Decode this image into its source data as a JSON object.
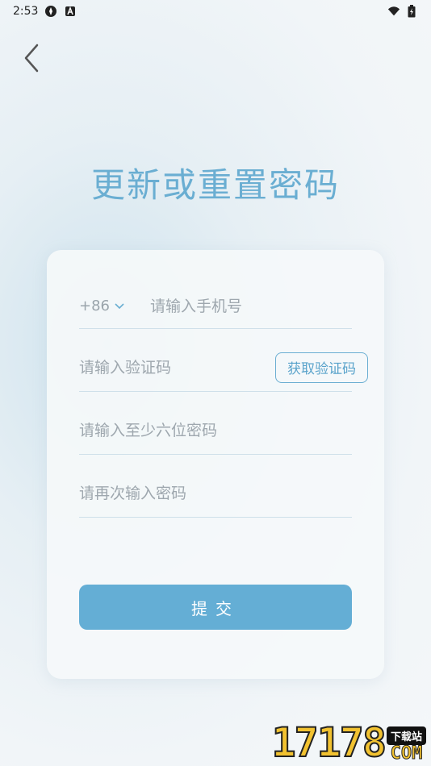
{
  "status_bar": {
    "time": "2:53"
  },
  "header": {
    "title": "更新或重置密码"
  },
  "form": {
    "country_code": "+86",
    "phone_placeholder": "请输入手机号",
    "code_placeholder": "请输入验证码",
    "get_code_label": "获取验证码",
    "password_placeholder": "请输入至少六位密码",
    "repeat_password_placeholder": "请再次输入密码",
    "submit_label": "提交"
  },
  "watermark": {
    "number": "17178",
    "badge": "下载站",
    "domain": "COM"
  },
  "colors": {
    "accent": "#64aed5",
    "title": "#6aaed2"
  }
}
